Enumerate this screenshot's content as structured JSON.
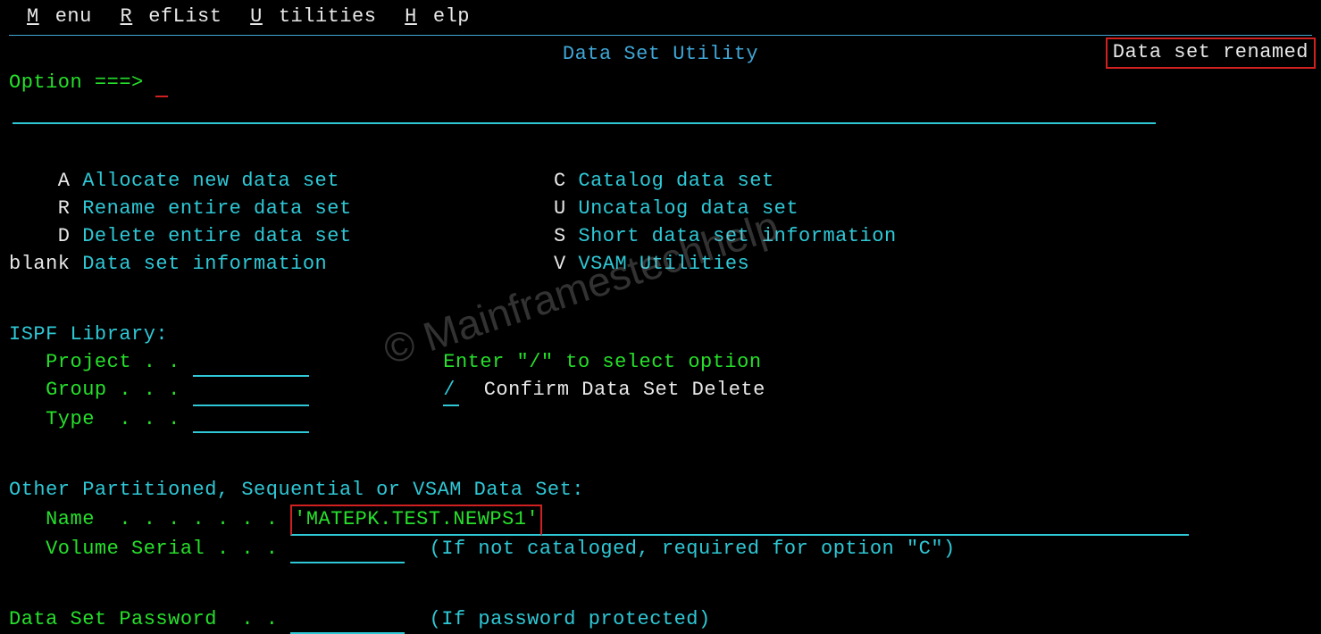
{
  "menu": {
    "items": [
      "Menu",
      "RefList",
      "Utilities",
      "Help"
    ]
  },
  "panel": {
    "title": "Data Set Utility",
    "status": "Data set renamed"
  },
  "option": {
    "prompt": "Option ===>",
    "value": ""
  },
  "options_left": [
    {
      "key": "A",
      "label": "Allocate new data set"
    },
    {
      "key": "R",
      "label": "Rename entire data set"
    },
    {
      "key": "D",
      "label": "Delete entire data set"
    },
    {
      "key": "blank",
      "label": "Data set information"
    }
  ],
  "options_right": [
    {
      "key": "C",
      "label": "Catalog data set"
    },
    {
      "key": "U",
      "label": "Uncatalog data set"
    },
    {
      "key": "S",
      "label": "Short data set information"
    },
    {
      "key": "V",
      "label": "VSAM Utilities"
    }
  ],
  "ispf": {
    "heading": "ISPF Library:",
    "project": {
      "label": "Project . .",
      "value": ""
    },
    "group": {
      "label": "Group . . .",
      "value": ""
    },
    "type": {
      "label": "Type  . . .",
      "value": ""
    }
  },
  "select_hint": "Enter \"/\" to select option",
  "confirm": {
    "value": "/",
    "label": "Confirm Data Set Delete"
  },
  "other": {
    "heading": "Other Partitioned, Sequential or VSAM Data Set:",
    "name_label": "Name  . . . . . . .",
    "name_value": "'MATEPK.TEST.NEWPS1'",
    "vol_label": "Volume Serial . . .",
    "vol_hint": "(If not cataloged, required for option \"C\")"
  },
  "password": {
    "label": "Data Set Password  . .",
    "hint": "(If password protected)"
  },
  "watermark": "© Mainframestechhelp"
}
